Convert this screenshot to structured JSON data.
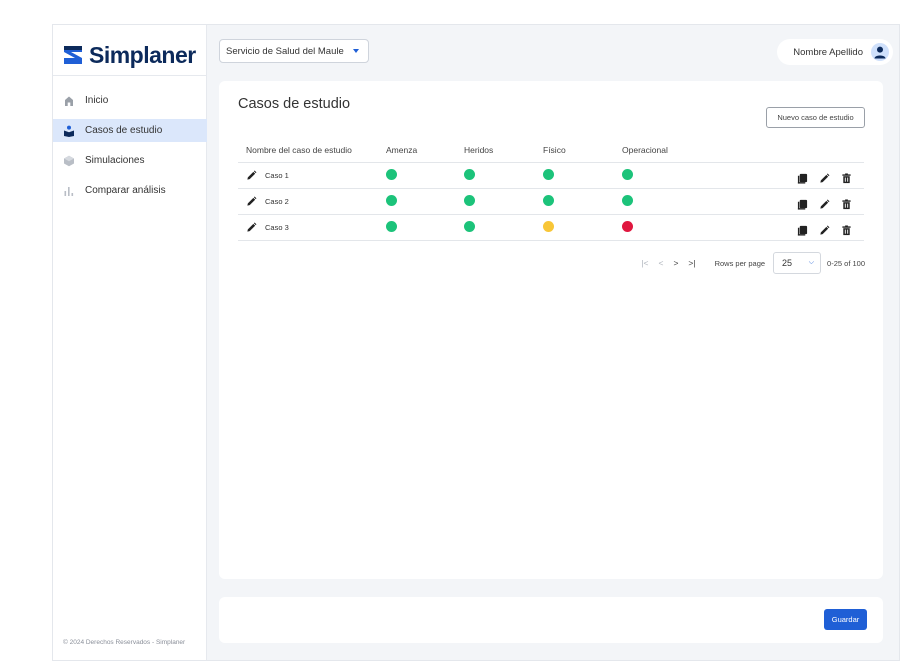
{
  "brand": {
    "name": "Simplaner",
    "color": "#0c2a5b"
  },
  "sidebar": {
    "items": [
      {
        "label": "Inicio",
        "icon": "home-icon",
        "active": false
      },
      {
        "label": "Casos de estudio",
        "icon": "cases-icon",
        "active": true
      },
      {
        "label": "Simulaciones",
        "icon": "cube-icon",
        "active": false
      },
      {
        "label": "Comparar análisis",
        "icon": "bar-chart-icon",
        "active": false
      }
    ],
    "footer": "© 2024 Derechos Reservados - Simplaner"
  },
  "topbar": {
    "organization": "Servicio de Salud del Maule",
    "user_name": "Nombre Apellido"
  },
  "main": {
    "title": "Casos de estudio",
    "new_button": "Nuevo caso de estudio",
    "table": {
      "headers": [
        "Nombre del caso de estudio",
        "Amenza",
        "Heridos",
        "Físico",
        "Operacional"
      ],
      "rows": [
        {
          "name": "Caso 1",
          "status": [
            "green",
            "green",
            "green",
            "green"
          ]
        },
        {
          "name": "Caso 2",
          "status": [
            "green",
            "green",
            "green",
            "green"
          ]
        },
        {
          "name": "Caso 3",
          "status": [
            "green",
            "green",
            "yellow",
            "red"
          ]
        }
      ]
    },
    "pagination": {
      "rows_per_page_label": "Rows per page",
      "rows_per_page": "25",
      "range": "0-25 of 100"
    }
  },
  "footer_bar": {
    "save_button": "Guardar"
  },
  "colors": {
    "accent": "#1f5fd6",
    "green": "#1cc37a",
    "yellow": "#f8c637",
    "red": "#e0173f",
    "active_nav": "#dbe7fb"
  }
}
